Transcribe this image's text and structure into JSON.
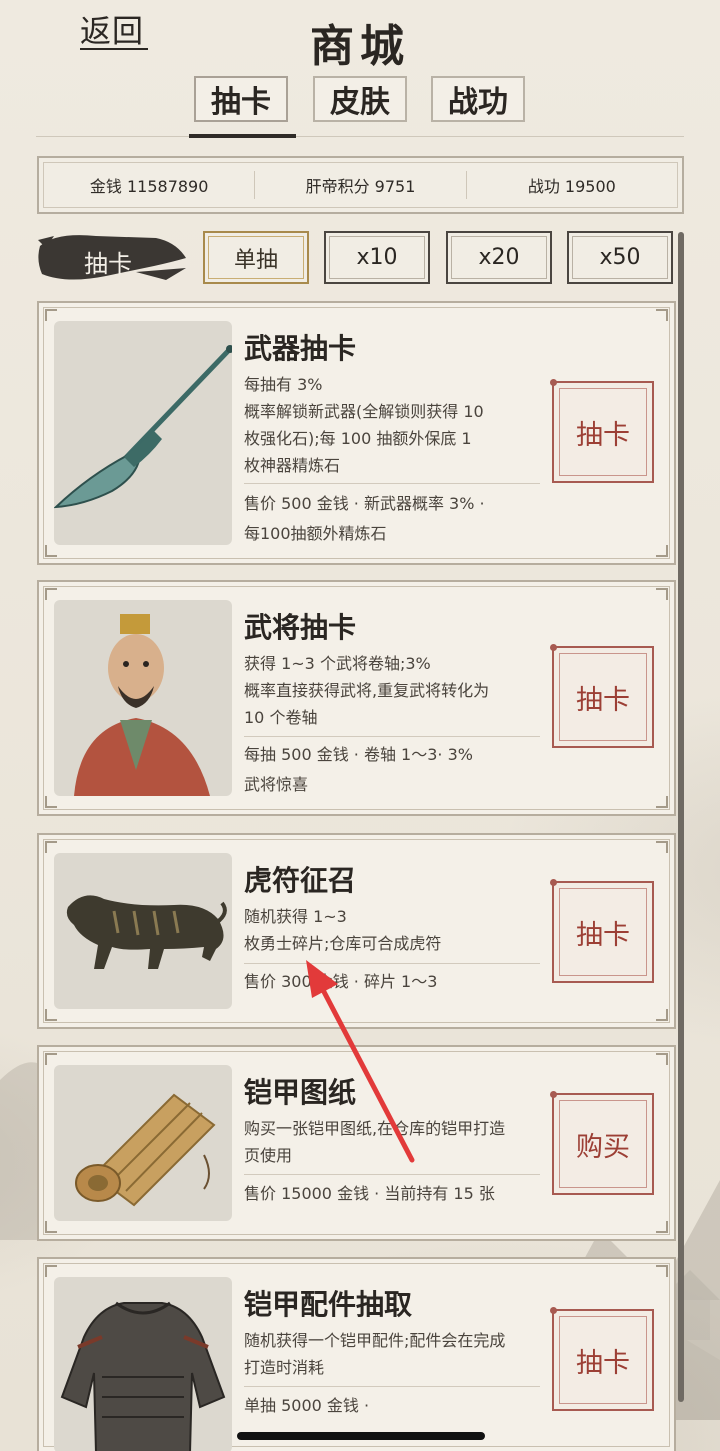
{
  "header": {
    "back_label": "返回",
    "title": "商城",
    "tabs": [
      {
        "label": "抽卡",
        "active": true
      },
      {
        "label": "皮肤",
        "active": false
      },
      {
        "label": "战功",
        "active": false
      }
    ]
  },
  "currency": {
    "money": "金钱 11587890",
    "points": "肝帝积分 9751",
    "merit": "战功 19500"
  },
  "draw_section": {
    "label": "抽卡",
    "options": [
      {
        "label": "单抽",
        "active": true
      },
      {
        "label": "x10",
        "active": false
      },
      {
        "label": "x20",
        "active": false
      },
      {
        "label": "x50",
        "active": false
      }
    ]
  },
  "cards": [
    {
      "title": "武器抽卡",
      "desc": [
        "每抽有 3%",
        "概率解锁新武器(全解锁则获得 10",
        "枚强化石);每 100 抽额外保底 1",
        "枚神器精炼石"
      ],
      "price": [
        "售价 500 金钱 · 新武器概率 3% ·",
        "每100抽额外精炼石"
      ],
      "button": "抽卡",
      "image_icon": "guandao-weapon-icon"
    },
    {
      "title": "武将抽卡",
      "desc": [
        "获得 1~3 个武将卷轴;3%",
        "概率直接获得武将,重复武将转化为",
        "10 个卷轴"
      ],
      "price": [
        "每抽 500 金钱 · 卷轴 1～3· 3%",
        "武将惊喜"
      ],
      "button": "抽卡",
      "image_icon": "general-portrait-icon"
    },
    {
      "title": "虎符征召",
      "desc": [
        "随机获得 1~3",
        "枚勇士碎片;仓库可合成虎符"
      ],
      "price": [
        "售价 300 金钱 · 碎片 1～3"
      ],
      "button": "抽卡",
      "image_icon": "tiger-tally-icon"
    },
    {
      "title": "铠甲图纸",
      "desc": [
        "购买一张铠甲图纸,在仓库的铠甲打造",
        "页使用"
      ],
      "price": [
        "售价 15000 金钱 · 当前持有 15 张"
      ],
      "button": "购买",
      "image_icon": "bamboo-scroll-icon"
    },
    {
      "title": "铠甲配件抽取",
      "desc": [
        "随机获得一个铠甲配件;配件会在完成",
        "打造时消耗"
      ],
      "price": [
        "单抽 5000 金钱 ·"
      ],
      "button": "抽卡",
      "image_icon": "armor-icon"
    }
  ],
  "colors": {
    "accent_red": "#a75a51",
    "active_gold": "#a88a4c",
    "annotation_arrow": "#e23a3a"
  }
}
